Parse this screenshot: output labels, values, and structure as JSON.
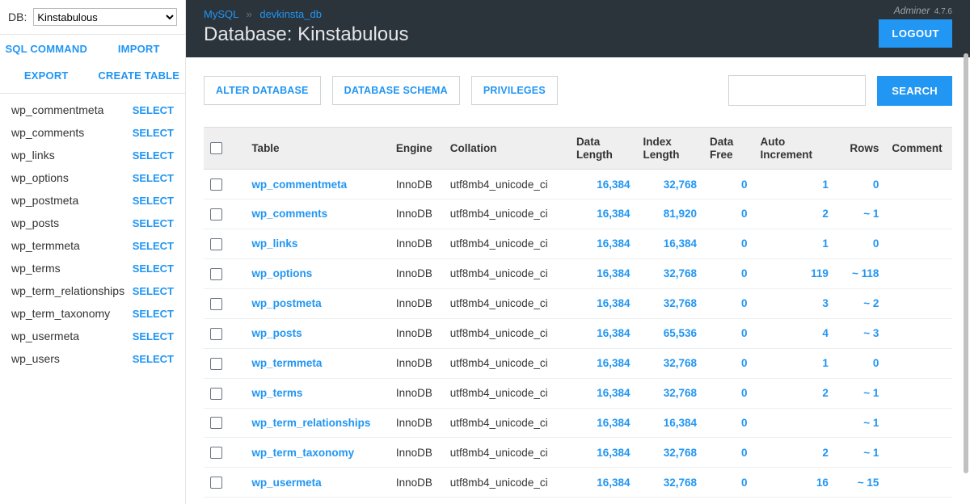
{
  "brand": {
    "name": "Adminer",
    "version": "4.7.6"
  },
  "logout_label": "LOGOUT",
  "sidebar": {
    "db_label": "DB:",
    "db_selected": "Kinstabulous",
    "actions": {
      "sql_command": "SQL COMMAND",
      "import": "IMPORT",
      "export": "EXPORT",
      "create_table": "CREATE TABLE"
    },
    "select_label": "SELECT",
    "tables": [
      "wp_commentmeta",
      "wp_comments",
      "wp_links",
      "wp_options",
      "wp_postmeta",
      "wp_posts",
      "wp_termmeta",
      "wp_terms",
      "wp_term_relationships",
      "wp_term_taxonomy",
      "wp_usermeta",
      "wp_users"
    ]
  },
  "header": {
    "crumb1": "MySQL",
    "crumb2": "devkinsta_db",
    "title": "Database: Kinstabulous"
  },
  "buttons": {
    "alter_database": "ALTER DATABASE",
    "database_schema": "DATABASE SCHEMA",
    "privileges": "PRIVILEGES",
    "search": "SEARCH"
  },
  "search": {
    "value": ""
  },
  "table": {
    "headers": {
      "table": "Table",
      "engine": "Engine",
      "collation": "Collation",
      "data_length": "Data Length",
      "index_length": "Index Length",
      "data_free": "Data Free",
      "auto_increment": "Auto Increment",
      "rows": "Rows",
      "comment": "Comment"
    },
    "rows": [
      {
        "table": "wp_commentmeta",
        "engine": "InnoDB",
        "collation": "utf8mb4_unicode_ci",
        "data_length": "16,384",
        "index_length": "32,768",
        "data_free": "0",
        "auto_increment": "1",
        "rows": "0"
      },
      {
        "table": "wp_comments",
        "engine": "InnoDB",
        "collation": "utf8mb4_unicode_ci",
        "data_length": "16,384",
        "index_length": "81,920",
        "data_free": "0",
        "auto_increment": "2",
        "rows": "~ 1"
      },
      {
        "table": "wp_links",
        "engine": "InnoDB",
        "collation": "utf8mb4_unicode_ci",
        "data_length": "16,384",
        "index_length": "16,384",
        "data_free": "0",
        "auto_increment": "1",
        "rows": "0"
      },
      {
        "table": "wp_options",
        "engine": "InnoDB",
        "collation": "utf8mb4_unicode_ci",
        "data_length": "16,384",
        "index_length": "32,768",
        "data_free": "0",
        "auto_increment": "119",
        "rows": "~ 118"
      },
      {
        "table": "wp_postmeta",
        "engine": "InnoDB",
        "collation": "utf8mb4_unicode_ci",
        "data_length": "16,384",
        "index_length": "32,768",
        "data_free": "0",
        "auto_increment": "3",
        "rows": "~ 2"
      },
      {
        "table": "wp_posts",
        "engine": "InnoDB",
        "collation": "utf8mb4_unicode_ci",
        "data_length": "16,384",
        "index_length": "65,536",
        "data_free": "0",
        "auto_increment": "4",
        "rows": "~ 3"
      },
      {
        "table": "wp_termmeta",
        "engine": "InnoDB",
        "collation": "utf8mb4_unicode_ci",
        "data_length": "16,384",
        "index_length": "32,768",
        "data_free": "0",
        "auto_increment": "1",
        "rows": "0"
      },
      {
        "table": "wp_terms",
        "engine": "InnoDB",
        "collation": "utf8mb4_unicode_ci",
        "data_length": "16,384",
        "index_length": "32,768",
        "data_free": "0",
        "auto_increment": "2",
        "rows": "~ 1"
      },
      {
        "table": "wp_term_relationships",
        "engine": "InnoDB",
        "collation": "utf8mb4_unicode_ci",
        "data_length": "16,384",
        "index_length": "16,384",
        "data_free": "0",
        "auto_increment": "",
        "rows": "~ 1"
      },
      {
        "table": "wp_term_taxonomy",
        "engine": "InnoDB",
        "collation": "utf8mb4_unicode_ci",
        "data_length": "16,384",
        "index_length": "32,768",
        "data_free": "0",
        "auto_increment": "2",
        "rows": "~ 1"
      },
      {
        "table": "wp_usermeta",
        "engine": "InnoDB",
        "collation": "utf8mb4_unicode_ci",
        "data_length": "16,384",
        "index_length": "32,768",
        "data_free": "0",
        "auto_increment": "16",
        "rows": "~ 15"
      }
    ]
  }
}
